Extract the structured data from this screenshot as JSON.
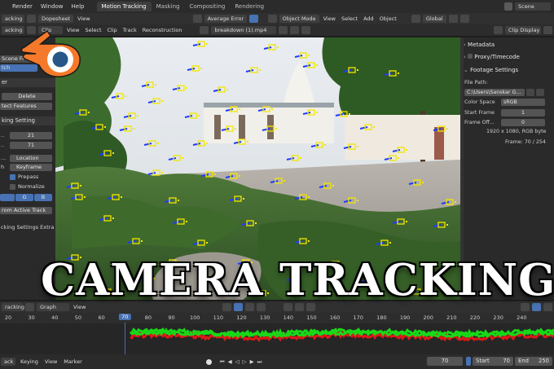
{
  "topbar": {
    "menus": [
      "Render",
      "Window",
      "Help"
    ],
    "workspaces": [
      "Motion Tracking",
      "Masking",
      "Compositing",
      "Rendering"
    ],
    "active_workspace": "Motion Tracking",
    "scene": "Scene"
  },
  "header_row1": {
    "left_mode": "acking",
    "dopesheet": "Dopesheet",
    "view": "View",
    "sort": "Average Error",
    "object_mode": "Object Mode",
    "menus": [
      "View",
      "Select",
      "Add",
      "Object"
    ],
    "orientation": "Global"
  },
  "header_row2": {
    "left_mode": "acking",
    "clip": "Clip",
    "menus": [
      "View",
      "Select",
      "Clip",
      "Track",
      "Reconstruction"
    ],
    "file": "breakdown (1).mp4",
    "clip_display": "Clip Display"
  },
  "left_panel": {
    "scene_frame": "Scene Fr",
    "tch": "tch",
    "section_er": "er",
    "delete": "Delete",
    "detect_features": "tect Features",
    "tracking_settings": "king Setting",
    "value_a": "21",
    "value_b": "71",
    "motion_model": "Location",
    "match": "Keyframe",
    "prepass": "Prepass",
    "normalize": "Normalize",
    "channel_g": "G",
    "channel_b": "B",
    "from_active_track": "rom Active Track",
    "tracking_extra": "cking Settings Extra"
  },
  "right_panel": {
    "metadata": "Metadata",
    "proxy_timecode": "Proxy/Timecode",
    "footage_settings": "Footage Settings",
    "file_path_label": "File Path:",
    "file_path": "C:\\Users\\Sanskar G...",
    "color_space_label": "Color Space",
    "color_space": "sRGB",
    "start_frame_label": "Start Frame",
    "start_frame": "1",
    "frame_offset_label": "Frame Off...",
    "frame_offset": "0",
    "resolution": "1920 x 1080, RGB byte",
    "frame_info": "Frame: 70 / 254"
  },
  "graph_header": {
    "left_mode": "racking",
    "graph": "Graph",
    "view": "View"
  },
  "ruler": {
    "ticks": [
      "20",
      "30",
      "40",
      "50",
      "60",
      "80",
      "90",
      "100",
      "110",
      "120",
      "130",
      "140",
      "150",
      "160",
      "170",
      "180",
      "190",
      "200",
      "210",
      "220",
      "230",
      "240"
    ],
    "playhead": "70"
  },
  "footer": {
    "playback": "ack",
    "keying": "Keying",
    "view": "View",
    "marker": "Marker",
    "current_frame": "70",
    "start_label": "Start",
    "start": "70",
    "end_label": "End",
    "end": "250"
  },
  "overlay": {
    "title": "CAMERA TRACKING"
  },
  "colors": {
    "accent": "#4772b3",
    "marker_yellow": "#f2e600",
    "marker_blue": "#1f3cff",
    "curve_red": "#e01818",
    "curve_green": "#18d818"
  }
}
